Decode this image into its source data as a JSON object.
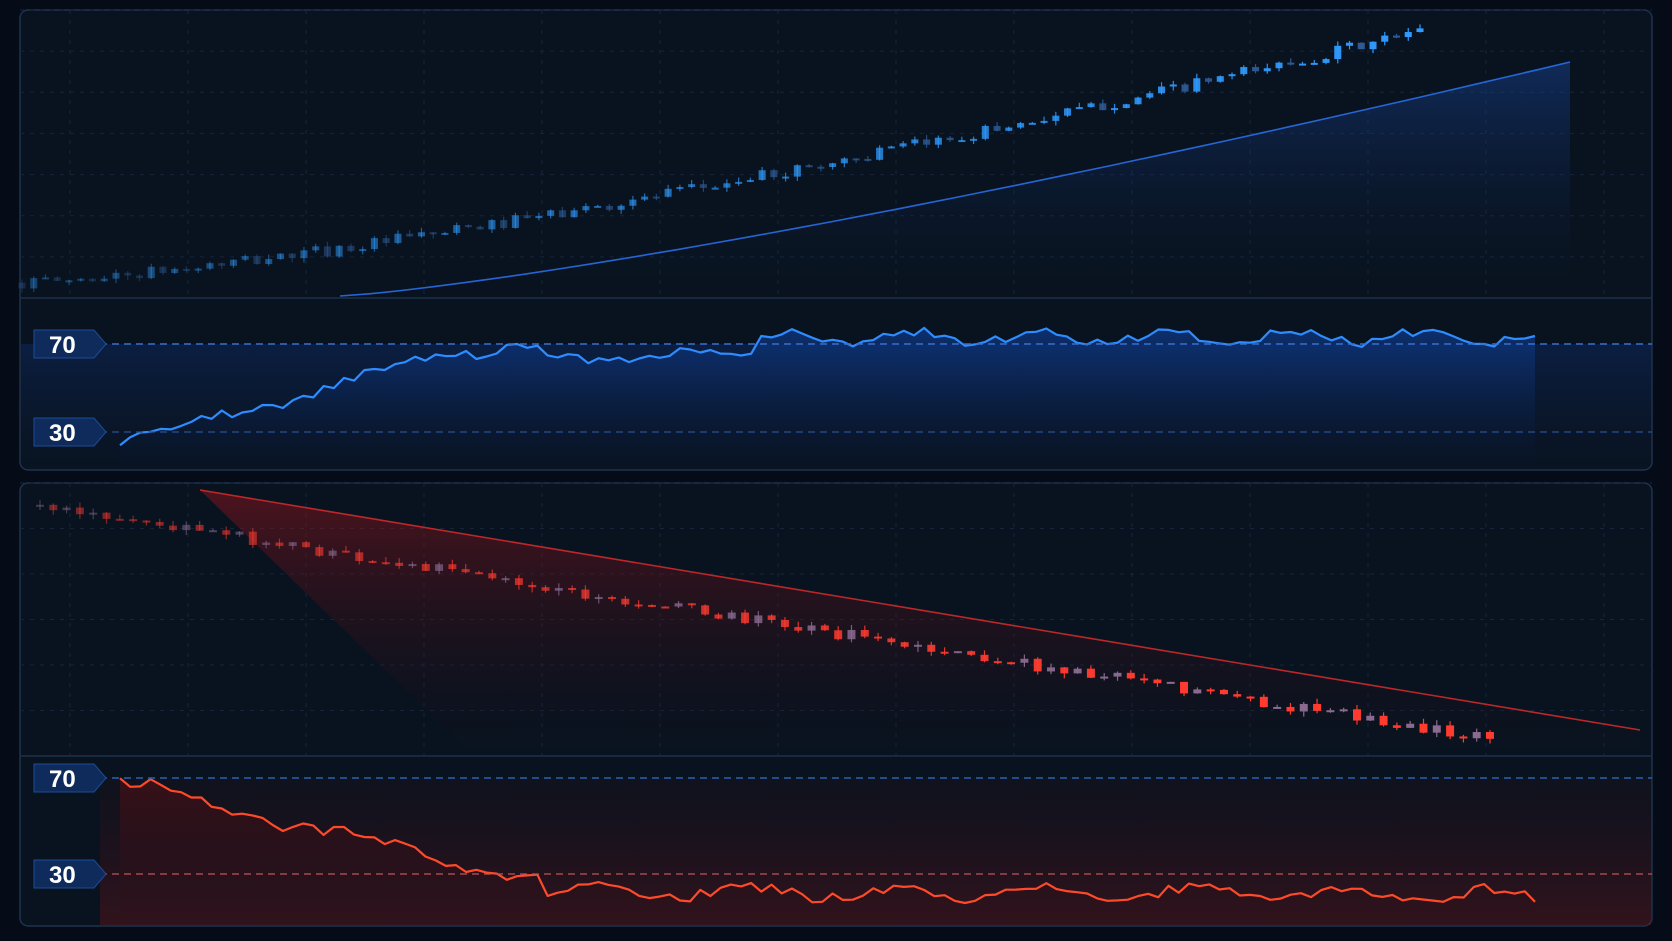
{
  "colors": {
    "background": "#050b17",
    "panel": "#0a1424",
    "panel_border": "#1f324d",
    "grid": "#15243a",
    "bull": "#2f9bff",
    "bull_dim": "#2f5c97",
    "bear": "#ff3b30",
    "bear_dim": "#8a6a90",
    "rsi_up": "#2f8cff",
    "rsi_down": "#ff4a2a",
    "level_blue": "#2d5fb0",
    "level_red": "#b8565a",
    "label_bg": "#0f2b5c"
  },
  "chart_data": [
    {
      "type": "candlestick",
      "panel": "upper",
      "trend": "rising",
      "series": [
        {
          "kind": "ohlc",
          "price_start": 100,
          "price_end": 540,
          "candles": 120,
          "ylim": [
            80,
            560
          ]
        },
        {
          "kind": "trendline",
          "from": 100,
          "to": 470
        }
      ],
      "rsi": {
        "levels": [
          "70",
          "30"
        ],
        "start": 28,
        "plateau": 74,
        "ylim": [
          20,
          90
        ]
      },
      "grid": true
    },
    {
      "type": "candlestick",
      "panel": "lower",
      "trend": "falling",
      "series": [
        {
          "kind": "ohlc",
          "price_start": 500,
          "price_end": 150,
          "candles": 110,
          "ylim": [
            130,
            520
          ]
        },
        {
          "kind": "trendline",
          "from": 505,
          "to": 170
        }
      ],
      "rsi": {
        "levels": [
          "70",
          "30"
        ],
        "start": 70,
        "floor": 28,
        "ylim": [
          18,
          78
        ]
      },
      "grid": true
    }
  ]
}
